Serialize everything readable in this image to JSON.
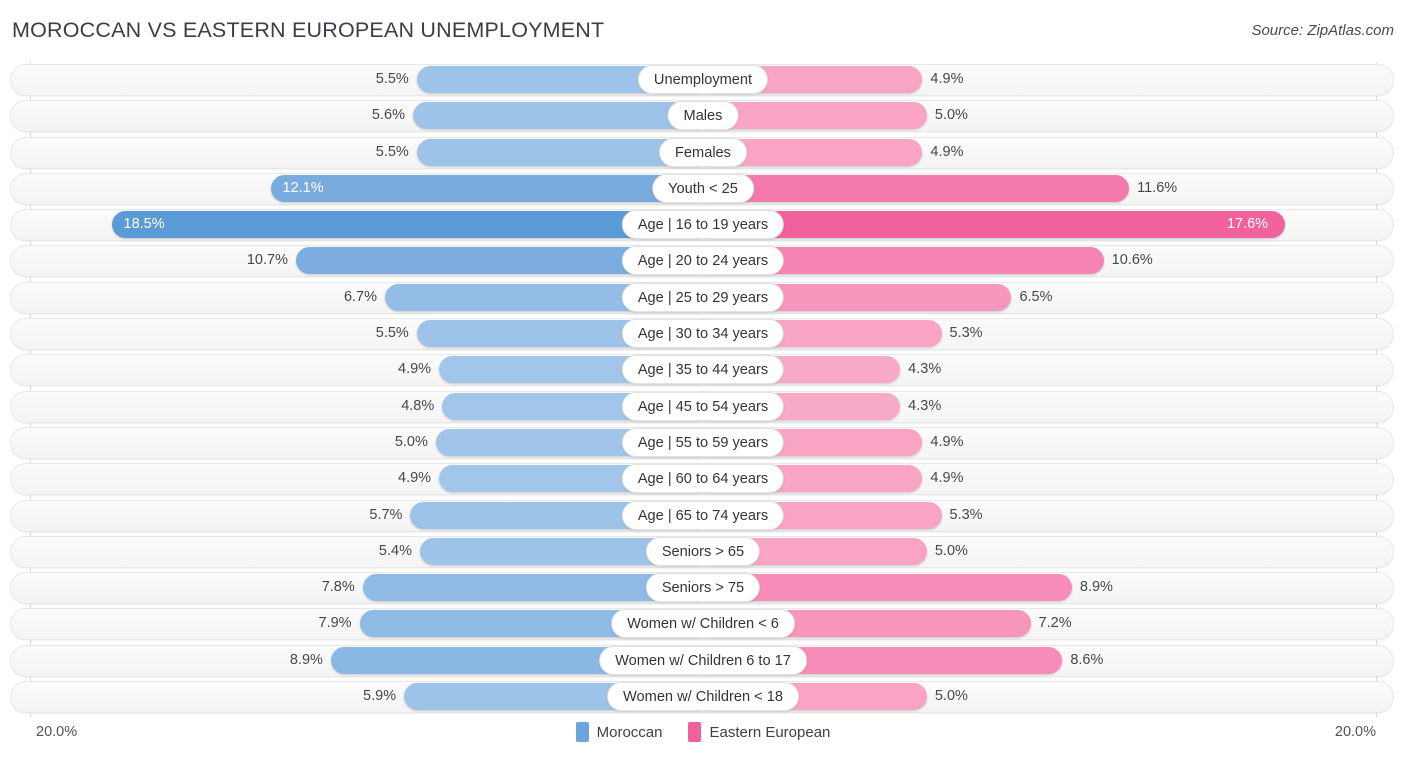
{
  "header": {
    "title": "MOROCCAN VS EASTERN EUROPEAN UNEMPLOYMENT",
    "source": "Source: ZipAtlas.com"
  },
  "legend": {
    "items": [
      {
        "label": "Moroccan",
        "color": "#6aa5de"
      },
      {
        "label": "Eastern European",
        "color": "#f1629c"
      }
    ]
  },
  "axis": {
    "left_label": "20.0%",
    "right_label": "20.0%",
    "max": 20.0
  },
  "chart_data": {
    "type": "bar",
    "orientation": "horizontal-diverging",
    "title": "MOROCCAN VS EASTERN EUROPEAN UNEMPLOYMENT",
    "xlabel": "",
    "ylabel": "",
    "xlim": [
      20.0,
      20.0
    ],
    "grid": true,
    "legend_position": "bottom-center",
    "categories": [
      "Unemployment",
      "Males",
      "Females",
      "Youth < 25",
      "Age | 16 to 19 years",
      "Age | 20 to 24 years",
      "Age | 25 to 29 years",
      "Age | 30 to 34 years",
      "Age | 35 to 44 years",
      "Age | 45 to 54 years",
      "Age | 55 to 59 years",
      "Age | 60 to 64 years",
      "Age | 65 to 74 years",
      "Seniors > 65",
      "Seniors > 75",
      "Women w/ Children < 6",
      "Women w/ Children 6 to 17",
      "Women w/ Children < 18"
    ],
    "series": [
      {
        "name": "Moroccan",
        "color": "#6aa5de",
        "values": [
          5.5,
          5.6,
          5.5,
          12.1,
          18.5,
          10.7,
          6.7,
          5.5,
          4.9,
          4.8,
          5.0,
          4.9,
          5.7,
          5.4,
          7.8,
          7.9,
          8.9,
          5.9
        ]
      },
      {
        "name": "Eastern European",
        "color": "#f1629c",
        "values": [
          4.9,
          5.0,
          4.9,
          11.6,
          17.6,
          10.6,
          6.5,
          5.3,
          4.3,
          4.3,
          4.9,
          4.9,
          5.3,
          5.0,
          8.9,
          7.2,
          8.6,
          5.0
        ]
      }
    ]
  },
  "rows": [
    {
      "label": "Unemployment",
      "left_value": "5.5%",
      "right_value": "4.9%",
      "left_pct": 45.0,
      "right_pct": 34.5,
      "left_color": "#9dc3e8",
      "right_color": "#f9a4c5",
      "left_inside": false,
      "right_inside": false
    },
    {
      "label": "Males",
      "left_value": "5.6%",
      "right_value": "5.0%",
      "left_pct": 45.6,
      "right_pct": 35.2,
      "left_color": "#9dc3e8",
      "right_color": "#f9a4c5",
      "left_inside": false,
      "right_inside": false
    },
    {
      "label": "Females",
      "left_value": "5.5%",
      "right_value": "4.9%",
      "left_pct": 45.0,
      "right_pct": 34.5,
      "left_color": "#9dc3e8",
      "right_color": "#f9a4c5",
      "left_inside": false,
      "right_inside": false
    },
    {
      "label": "Youth < 25",
      "left_value": "12.1%",
      "right_value": "11.6%",
      "left_pct": 68.0,
      "right_pct": 67.0,
      "left_color": "#79abdf",
      "right_color": "#f57aac",
      "left_inside": true,
      "right_inside": false
    },
    {
      "label": "Age | 16 to 19 years",
      "left_value": "18.5%",
      "right_value": "17.6%",
      "left_pct": 93.0,
      "right_pct": 91.5,
      "left_color": "#5b9bd5",
      "right_color": "#f1629c",
      "left_inside": true,
      "right_inside": true
    },
    {
      "label": "Age | 20 to 24 years",
      "left_value": "10.7%",
      "right_value": "10.6%",
      "left_pct": 64.0,
      "right_pct": 63.0,
      "left_color": "#7dade0",
      "right_color": "#f684b3",
      "left_inside": false,
      "right_inside": false
    },
    {
      "label": "Age | 25 to 29 years",
      "left_value": "6.7%",
      "right_value": "6.5%",
      "left_pct": 50.0,
      "right_pct": 48.5,
      "left_color": "#93bde6",
      "right_color": "#f897be",
      "left_inside": false,
      "right_inside": false
    },
    {
      "label": "Age | 30 to 34 years",
      "left_value": "5.5%",
      "right_value": "5.3%",
      "left_pct": 45.0,
      "right_pct": 37.5,
      "left_color": "#9dc3e8",
      "right_color": "#f9a4c5",
      "left_inside": false,
      "right_inside": false
    },
    {
      "label": "Age | 35 to 44 years",
      "left_value": "4.9%",
      "right_value": "4.3%",
      "left_pct": 41.5,
      "right_pct": 31.0,
      "left_color": "#a2c6e9",
      "right_color": "#f9a9c8",
      "left_inside": false,
      "right_inside": false
    },
    {
      "label": "Age | 45 to 54 years",
      "left_value": "4.8%",
      "right_value": "4.3%",
      "left_pct": 41.0,
      "right_pct": 31.0,
      "left_color": "#a2c6e9",
      "right_color": "#f9a9c8",
      "left_inside": false,
      "right_inside": false
    },
    {
      "label": "Age | 55 to 59 years",
      "left_value": "5.0%",
      "right_value": "4.9%",
      "left_pct": 42.0,
      "right_pct": 34.5,
      "left_color": "#a0c5e9",
      "right_color": "#f9a4c5",
      "left_inside": false,
      "right_inside": false
    },
    {
      "label": "Age | 60 to 64 years",
      "left_value": "4.9%",
      "right_value": "4.9%",
      "left_pct": 41.5,
      "right_pct": 34.5,
      "left_color": "#a2c6e9",
      "right_color": "#f9a4c5",
      "left_inside": false,
      "right_inside": false
    },
    {
      "label": "Age | 65 to 74 years",
      "left_value": "5.7%",
      "right_value": "5.3%",
      "left_pct": 46.0,
      "right_pct": 37.5,
      "left_color": "#9dc3e8",
      "right_color": "#f9a4c5",
      "left_inside": false,
      "right_inside": false
    },
    {
      "label": "Seniors > 65",
      "left_value": "5.4%",
      "right_value": "5.0%",
      "left_pct": 44.5,
      "right_pct": 35.2,
      "left_color": "#9dc3e8",
      "right_color": "#f9a4c5",
      "left_inside": false,
      "right_inside": false
    },
    {
      "label": "Seniors > 75",
      "left_value": "7.8%",
      "right_value": "8.9%",
      "left_pct": 53.5,
      "right_pct": 58.0,
      "left_color": "#8fbae5",
      "right_color": "#f68cb7",
      "left_inside": false,
      "right_inside": false
    },
    {
      "label": "Women w/ Children < 6",
      "left_value": "7.9%",
      "right_value": "7.2%",
      "left_pct": 54.0,
      "right_pct": 51.5,
      "left_color": "#8fbae5",
      "right_color": "#f795bd",
      "left_inside": false,
      "right_inside": false
    },
    {
      "label": "Women w/ Children 6 to 17",
      "left_value": "8.9%",
      "right_value": "8.6%",
      "left_pct": 58.5,
      "right_pct": 56.5,
      "left_color": "#8ab7e3",
      "right_color": "#f68cb7",
      "left_inside": false,
      "right_inside": false
    },
    {
      "label": "Women w/ Children < 18",
      "left_value": "5.9%",
      "right_value": "5.0%",
      "left_pct": 47.0,
      "right_pct": 35.2,
      "left_color": "#9dc3e8",
      "right_color": "#f9a4c5",
      "left_inside": false,
      "right_inside": false
    }
  ]
}
